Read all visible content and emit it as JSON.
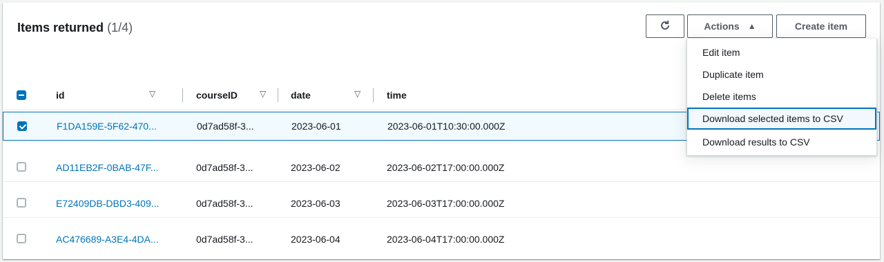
{
  "header": {
    "title": "Items returned",
    "count": "(1/4)"
  },
  "toolbar": {
    "refresh_icon": "refresh-icon",
    "actions_label": "Actions",
    "actions_caret": "▲",
    "create_label": "Create item"
  },
  "actions_menu": {
    "items": [
      {
        "label": "Edit item"
      },
      {
        "label": "Duplicate item"
      },
      {
        "label": "Delete items"
      },
      {
        "label": "Download selected items to CSV",
        "highlighted": true
      },
      {
        "label": "Download results to CSV"
      }
    ]
  },
  "table": {
    "columns": [
      {
        "label": "id",
        "sortable": true
      },
      {
        "label": "courseID",
        "sortable": true
      },
      {
        "label": "date",
        "sortable": true
      },
      {
        "label": "time",
        "sortable": false
      }
    ],
    "sort_icon": "▽",
    "rows": [
      {
        "selected": true,
        "id": "F1DA159E-5F62-470...",
        "courseID": "0d7ad58f-3...",
        "date": "2023-06-01",
        "time": "2023-06-01T10:30:00.000Z"
      },
      {
        "selected": false,
        "id": "AD11EB2F-0BAB-47F...",
        "courseID": "0d7ad58f-3...",
        "date": "2023-06-02",
        "time": "2023-06-02T17:00:00.000Z"
      },
      {
        "selected": false,
        "id": "E72409DB-DBD3-409...",
        "courseID": "0d7ad58f-3...",
        "date": "2023-06-03",
        "time": "2023-06-03T17:00:00.000Z"
      },
      {
        "selected": false,
        "id": "AC476689-A3E4-4DA...",
        "courseID": "0d7ad58f-3...",
        "date": "2023-06-04",
        "time": "2023-06-04T17:00:00.000Z"
      }
    ]
  },
  "colors": {
    "accent": "#0073bb",
    "selected_row_bg": "#f1faff",
    "text": "#16191f",
    "muted": "#545b64"
  }
}
